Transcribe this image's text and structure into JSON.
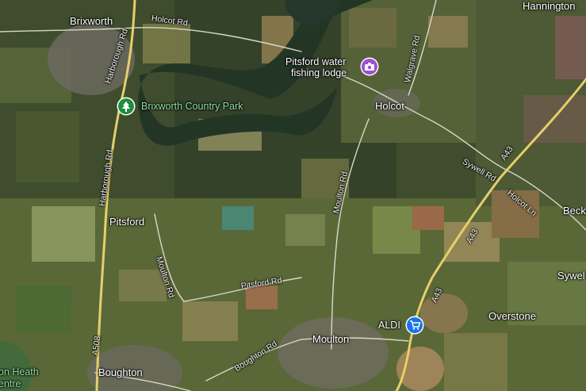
{
  "map": {
    "places": {
      "brixworth": "Brixworth",
      "hannington": "Hannington",
      "holcot": "Holcot",
      "pitsford": "Pitsford",
      "moulton": "Moulton",
      "overstone": "Overstone",
      "boughton": "Boughton",
      "beck": "Beck",
      "sywe": "Sywel"
    },
    "roads": {
      "holcot_rd": "Holcot Rd",
      "harborough_rd_1": "Harborough Rd",
      "harborough_rd_2": "Harborough Rd",
      "walgrave_rd": "Walgrave Rd",
      "moulton_rd_1": "Moulton Rd",
      "moulton_rd_2": "Moulton Rd",
      "sywell_rd": "Sywell Rd",
      "holcot_ln": "Holcot Ln",
      "a43_1": "A43",
      "a43_2": "A43",
      "a43_3": "A43",
      "a508": "A508",
      "pitsford_rd": "Pitsford Rd",
      "boughton_rd": "Boughton Rd"
    },
    "pois": {
      "country_park": {
        "label": "Brixworth Country Park",
        "icon": "tree-icon",
        "color": "#1e8e3e"
      },
      "fishing_lodge": {
        "label_line1": "Pitsford water",
        "label_line2": "fishing lodge",
        "icon": "camera-icon",
        "color": "#9c4fd6"
      },
      "aldi": {
        "label": "ALDI",
        "icon": "shopping-cart-icon",
        "color": "#1a73e8"
      }
    },
    "edge_text": {
      "heath_line1": "on Heath",
      "heath_line2": "entre"
    }
  }
}
